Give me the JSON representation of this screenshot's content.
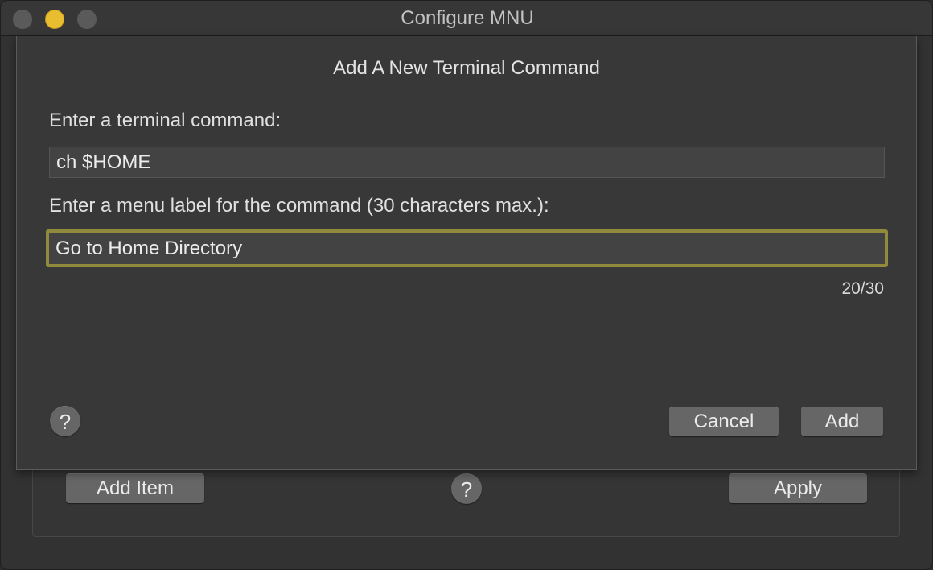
{
  "window": {
    "title": "Configure MNU"
  },
  "main": {
    "add_item_label": "Add Item",
    "help_label": "?",
    "apply_label": "Apply"
  },
  "sheet": {
    "title": "Add A New Terminal Command",
    "command_label": "Enter a terminal command:",
    "command_value": "ch $HOME",
    "menu_label": "Enter a menu label for the command (30 characters max.):",
    "menu_value": "Go to Home Directory",
    "char_count": "20/30",
    "help_label": "?",
    "cancel_label": "Cancel",
    "add_label": "Add"
  },
  "colors": {
    "focus_ring": "#8f8a3c",
    "minimize": "#e8bd2f"
  }
}
